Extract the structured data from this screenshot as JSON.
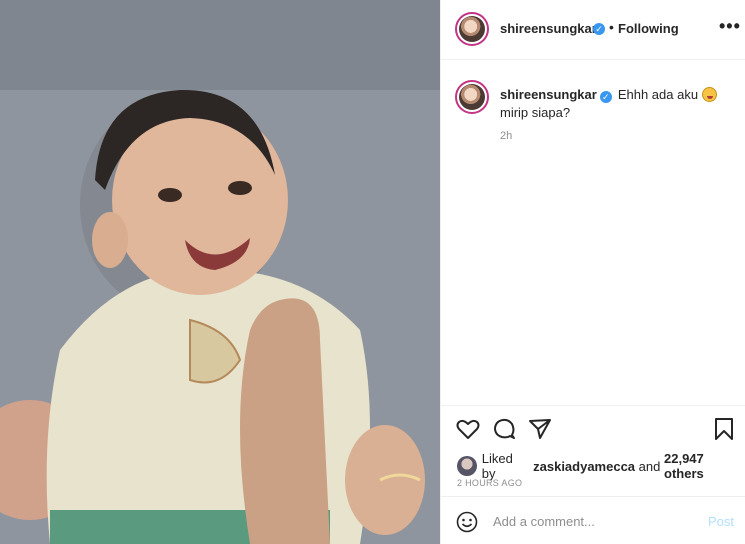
{
  "post": {
    "image_alt": "Baby photo",
    "username": "shireensungkar",
    "follow_label": "Following",
    "more_label": "•••",
    "caption_text": "Ehhh ada aku",
    "caption_text_2": "mirip siapa?",
    "caption_time": "2h",
    "likes": {
      "prefix": "Liked by",
      "user": "zaskiadyamecca",
      "middle": "and",
      "count": "22,947 others"
    },
    "posted_ago": "2 HOURS AGO"
  },
  "comment_box": {
    "placeholder": "Add a comment...",
    "post_label": "Post"
  },
  "icons": [
    "heart-icon",
    "comment-icon",
    "share-icon",
    "bookmark-icon",
    "smile-icon",
    "verified-badge-icon"
  ],
  "colors": {
    "verified": "#3897f0",
    "post_disabled": "#b2dffc",
    "story_ring": "#c13584"
  }
}
